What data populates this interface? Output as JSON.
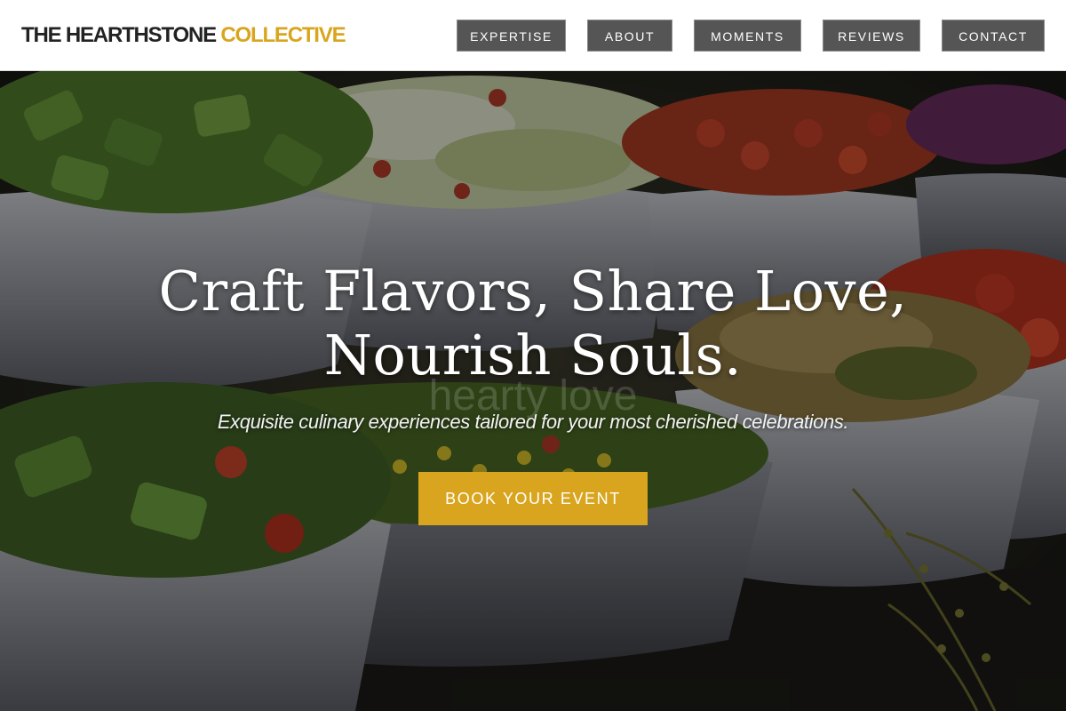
{
  "header": {
    "brand_main": "THE HEARTHSTONE",
    "brand_accent": "COLLECTIVE",
    "nav": [
      {
        "label": "EXPERTISE"
      },
      {
        "label": "ABOUT"
      },
      {
        "label": "MOMENTS"
      },
      {
        "label": "REVIEWS"
      },
      {
        "label": "CONTACT"
      }
    ]
  },
  "hero": {
    "title_line1": "Craft Flavors, Share Love,",
    "title_line2": "Nourish Souls.",
    "watermark": "hearty love",
    "subtitle": "Exquisite culinary experiences tailored for your most cherished celebrations.",
    "cta_label": "BOOK YOUR EVENT",
    "background_image": "salad-bowls-buffet-photo"
  },
  "colors": {
    "accent": "#d9a51e",
    "nav_button": "#555555",
    "brand_dark": "#222222",
    "header_bg": "#ffffff"
  }
}
